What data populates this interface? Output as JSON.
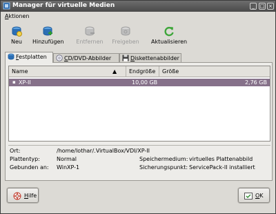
{
  "window": {
    "title": "Manager für virtuelle Medien",
    "controls": {
      "minimize": "_",
      "maximize": "□",
      "close": "×"
    }
  },
  "menubar": {
    "items": [
      {
        "mnemonic": "A",
        "rest": "ktionen"
      }
    ]
  },
  "toolbar": {
    "buttons": [
      {
        "label": "Neu",
        "icon": "new-disk-icon",
        "enabled": true
      },
      {
        "label": "Hinzufügen",
        "icon": "add-disk-icon",
        "enabled": true
      },
      {
        "label": "Entfernen",
        "icon": "remove-disk-icon",
        "enabled": false
      },
      {
        "label": "Freigeben",
        "icon": "release-disk-icon",
        "enabled": false
      },
      {
        "label": "Aktualisieren",
        "icon": "refresh-icon",
        "enabled": true
      }
    ]
  },
  "tabs": [
    {
      "mnemonic": "F",
      "rest": "estplatten",
      "icon": "hard-disk-icon",
      "active": true
    },
    {
      "mnemonic": "C",
      "rest": "D/DVD-Abbilder",
      "icon": "cd-dvd-icon",
      "active": false
    },
    {
      "mnemonic": "D",
      "rest": "iskettenabbilder",
      "icon": "floppy-icon",
      "active": false
    }
  ],
  "table": {
    "columns": {
      "name": "Name",
      "sort_indicator": "▲",
      "size_max": "Endgröße",
      "size": "Größe"
    },
    "rows": [
      {
        "expander": "▪",
        "name": "XP-II",
        "size_max": "10,00 GB",
        "size": "2,76 GB",
        "selected": true
      }
    ]
  },
  "details": {
    "location_label": "Ort:",
    "location_value": "/home/lothar/.VirtualBox/VDI/XP-II",
    "disk_type_label": "Plattentyp:",
    "disk_type_value": "Normal",
    "storage_label": "Speichermedium:",
    "storage_value": "virtuelles Plattenabbild",
    "attached_label": "Gebunden an:",
    "attached_value": "WinXP-1",
    "snapshot_label": "Sicherungspunkt:",
    "snapshot_value": "ServicePack-II installiert"
  },
  "buttons": {
    "help": {
      "mnemonic": "H",
      "rest": "ilfe"
    },
    "ok": {
      "mnemonic": "O",
      "rest": "K"
    }
  },
  "colors": {
    "selection": "#86718a",
    "toolbar_blue": "#2c6fb4",
    "refresh_green": "#3ea63a"
  }
}
